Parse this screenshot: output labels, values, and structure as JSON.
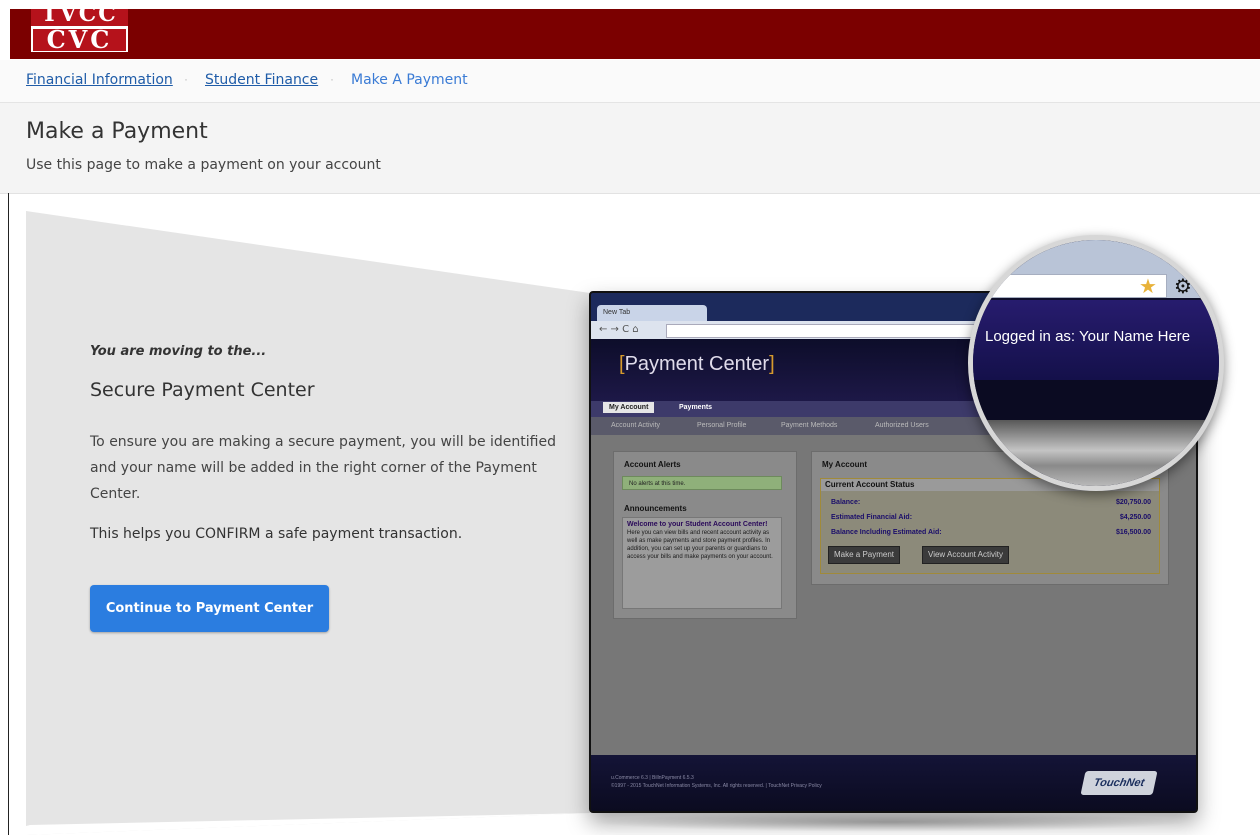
{
  "logo": {
    "line1": "TVCC",
    "line2": "CVC"
  },
  "breadcrumb": {
    "items": [
      {
        "label": "Financial Information"
      },
      {
        "label": "Student Finance"
      }
    ],
    "separator": "·",
    "current": "Make A Payment"
  },
  "page": {
    "title": "Make a Payment",
    "subtitle": "Use this page to make a payment on your account"
  },
  "notice": {
    "moving": "You are moving to the...",
    "heading": "Secure Payment Center",
    "paragraph1": "To ensure you are making a secure payment, you will be identified and your name will be added in the right corner of the Payment Center.",
    "paragraph2": "This helps you CONFIRM a safe payment transaction.",
    "button": "Continue to Payment Center"
  },
  "preview": {
    "tab_label": "New Tab",
    "nav": "← → C ⌂",
    "title_open": "[",
    "title": "Payment Center",
    "title_close": "]",
    "tabs": [
      "My Account",
      "Payments"
    ],
    "subtabs": [
      "Account Activity",
      "Personal Profile",
      "Payment Methods",
      "Authorized Users"
    ],
    "alerts_title": "Account Alerts",
    "alerts_text": "No alerts at this time.",
    "announcements_title": "Announcements",
    "welcome_title": "Welcome to your Student Account Center!",
    "welcome_text": "Here you can view bills and recent account activity as well as make payments and store payment profiles. In addition, you can set up your parents or guardians to access your bills and make payments on your account.",
    "my_account_title": "My Account",
    "status_title": "Current Account Status",
    "rows": [
      {
        "label": "Balance:",
        "value": "$20,750.00"
      },
      {
        "label": "Estimated Financial Aid:",
        "value": "$4,250.00"
      },
      {
        "label": "Balance Including Estimated Aid:",
        "value": "$16,500.00"
      }
    ],
    "btn_pay": "Make a Payment",
    "btn_activity": "View Account Activity",
    "footer1": "u.Commerce 6.3 | BillnPayment 6.5.3",
    "footer2": "©1997 - 2015 TouchNet Information Systems, Inc. All rights reserved. | TouchNet Privacy Policy",
    "touchnet": "TouchNet"
  },
  "magnifier": {
    "login_text": "Logged in as: Your Name Here"
  },
  "icons": {
    "star": "star-icon",
    "gear": "gear-icon"
  },
  "colors": {
    "brand": "#7b0000",
    "link": "#1f5ca8",
    "button": "#2b7de0"
  }
}
